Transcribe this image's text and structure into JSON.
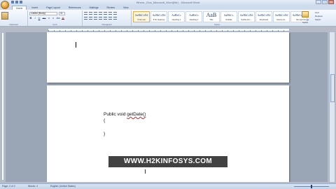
{
  "window": {
    "title": "Where_Clos_Microsoft_Word(Mir) - Microsoft Word",
    "controls": {
      "minimize": "_",
      "maximize": "□",
      "close": "x"
    }
  },
  "tabs": [
    "Home",
    "Insert",
    "Page Layout",
    "References",
    "Mailings",
    "Review",
    "View"
  ],
  "ribbon": {
    "clipboard_label": "Clipboard",
    "font": {
      "name": "Calibri (Body)",
      "size": "11",
      "format_buttons": [
        "B",
        "I",
        "U",
        "abc",
        "x",
        "x",
        "Aa",
        "A"
      ]
    },
    "font_label": "Font",
    "paragraph_label": "Paragraph",
    "styles": [
      {
        "sample": "AaBbCcDd",
        "name": "¶ Normal"
      },
      {
        "sample": "AaBbCcDd",
        "name": "¶ No Spacing"
      },
      {
        "sample": "AaBbCc",
        "name": "Heading 1"
      },
      {
        "sample": "AaBbCc",
        "name": "Heading 2"
      },
      {
        "sample": "AaB",
        "name": "Title"
      },
      {
        "sample": "AaBbCc.",
        "name": "Subtitle"
      },
      {
        "sample": "AaBbCcDd",
        "name": "Subtle Em..."
      },
      {
        "sample": "AaBbCcDd",
        "name": "Emphasis"
      },
      {
        "sample": "AaBbCcDd",
        "name": "Intense E..."
      },
      {
        "sample": "AaBbCcDd",
        "name": "Strong"
      }
    ],
    "styles_label": "Styles",
    "change_styles": "Change Styles",
    "editing": [
      "Find",
      "Replace",
      "Select"
    ],
    "editing_label": "Editing"
  },
  "document": {
    "lines": [
      "Public void getDate()",
      "{",
      "",
      "}"
    ],
    "squiggle_word": "getDate"
  },
  "watermark": "WWW.H2KINFOSYS.COM",
  "status": {
    "page": "Page: 2 of 2",
    "words": "Words: 4",
    "language": "English (United States)"
  }
}
